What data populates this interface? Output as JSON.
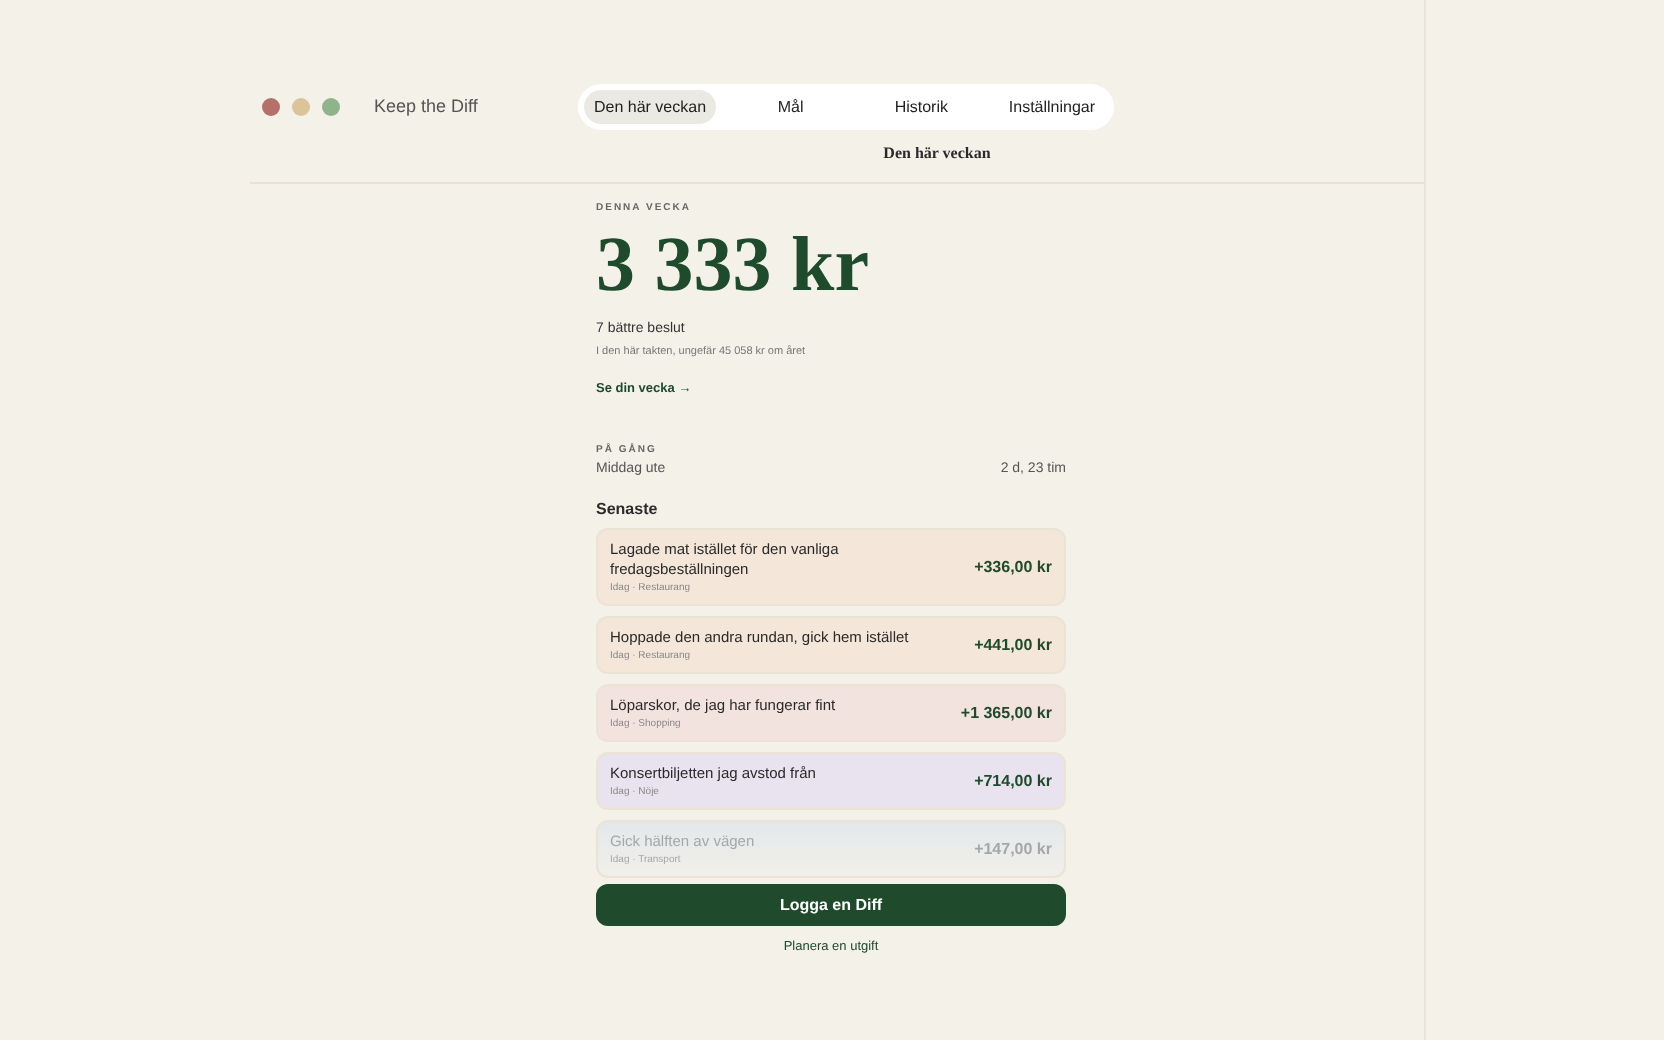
{
  "app": {
    "title": "Keep the Diff"
  },
  "tabs": [
    {
      "label": "Den här veckan",
      "selected": true
    },
    {
      "label": "Mål",
      "selected": false
    },
    {
      "label": "Historik",
      "selected": false
    },
    {
      "label": "Inställningar",
      "selected": false
    }
  ],
  "page_title": "Den här veckan",
  "summary": {
    "eyebrow": "DENNA VECKA",
    "amount": "3 333 kr",
    "decisions": "7 bättre beslut",
    "projection": "I den här takten, ungefär 45 058 kr om året",
    "link": "Se din vecka →"
  },
  "upcoming": {
    "eyebrow": "PÅ GÅNG",
    "name": "Middag ute",
    "time": "2 d, 23 tim"
  },
  "recent": {
    "heading": "Senaste",
    "items": [
      {
        "title": "Lagade mat istället för den vanliga fredagsbeställningen",
        "meta": "Idag · Restaurang",
        "amount": "+336,00 kr",
        "color": "#f4e6d8",
        "faded": false
      },
      {
        "title": "Hoppade den andra rundan, gick hem istället",
        "meta": "Idag · Restaurang",
        "amount": "+441,00 kr",
        "color": "#f4e6d8",
        "faded": false
      },
      {
        "title": "Löparskor, de jag har fungerar fint",
        "meta": "Idag · Shopping",
        "amount": "+1 365,00 kr",
        "color": "#f3e3de",
        "faded": false
      },
      {
        "title": "Konsertbiljetten jag avstod från",
        "meta": "Idag · Nöje",
        "amount": "+714,00 kr",
        "color": "#e9e3ef",
        "faded": false
      },
      {
        "title": "Gick hälften av vägen",
        "meta": "Idag · Transport",
        "amount": "+147,00 kr",
        "color": "#e4e8ec",
        "faded": true
      }
    ]
  },
  "primary_button": "Logga en Diff",
  "secondary_link": "Planera en utgift"
}
